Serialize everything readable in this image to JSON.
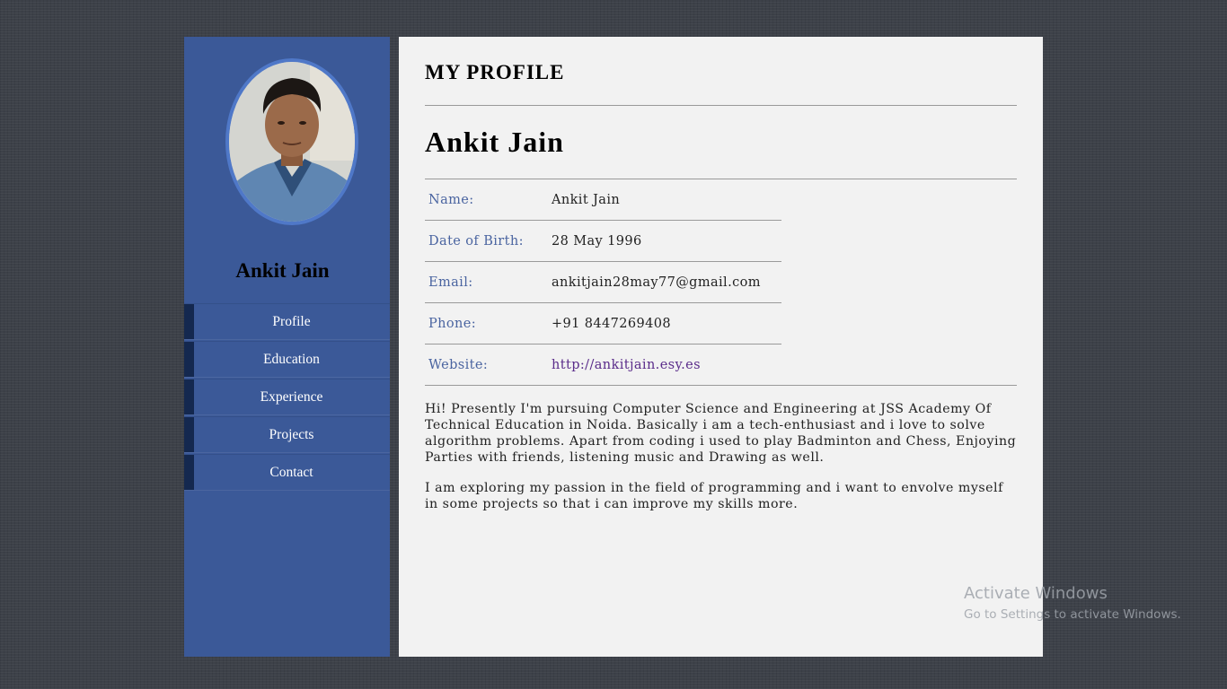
{
  "sidebar": {
    "name": "Ankit Jain",
    "nav": [
      {
        "label": "Profile"
      },
      {
        "label": "Education"
      },
      {
        "label": "Experience"
      },
      {
        "label": "Projects"
      },
      {
        "label": "Contact"
      }
    ]
  },
  "main": {
    "title": "MY PROFILE",
    "name": "Ankit Jain",
    "details": [
      {
        "label": "Name:",
        "value": "Ankit Jain"
      },
      {
        "label": "Date of Birth:",
        "value": "28 May 1996"
      },
      {
        "label": "Email:",
        "value": "ankitjain28may77@gmail.com"
      },
      {
        "label": "Phone:",
        "value": "+91 8447269408"
      },
      {
        "label": "Website:",
        "value": "http://ankitjain.esy.es"
      }
    ],
    "about": [
      "Hi! Presently I'm pursuing Computer Science and Engineering at JSS Academy Of Technical Education in Noida. Basically i am a tech-enthusiast and i love to solve algorithm problems. Apart from coding i used to play Badminton and Chess, Enjoying Parties with friends, listening music and Drawing as well.",
      "I am exploring my passion in the field of programming and i want to envolve myself in some projects so that i can improve my skills more."
    ]
  },
  "watermark": {
    "title": "Activate Windows",
    "subtitle": "Go to Settings to activate Windows."
  }
}
